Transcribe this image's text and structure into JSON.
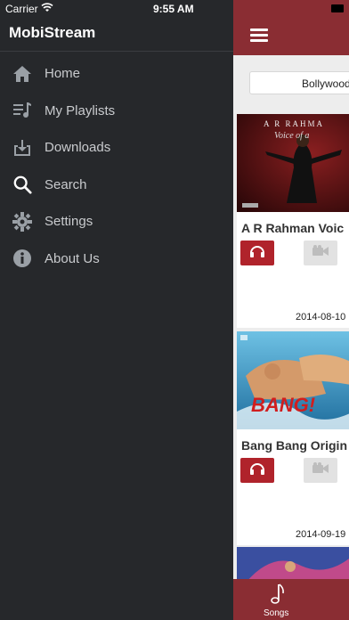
{
  "status": {
    "carrier": "Carrier",
    "time": "9:55 AM"
  },
  "drawer": {
    "title": "MobiStream",
    "items": [
      {
        "label": "Home",
        "icon": "home-icon"
      },
      {
        "label": "My Playlists",
        "icon": "playlist-icon"
      },
      {
        "label": "Downloads",
        "icon": "download-icon"
      },
      {
        "label": "Search",
        "icon": "search-icon"
      },
      {
        "label": "Settings",
        "icon": "gear-icon"
      },
      {
        "label": "About Us",
        "icon": "info-icon"
      }
    ]
  },
  "content": {
    "category": "Bollywood",
    "albums": [
      {
        "title": "A R Rahman Voic",
        "date": "2014-08-10"
      },
      {
        "title": "Bang Bang Origin",
        "date": "2014-09-19"
      }
    ],
    "tab": {
      "label": "Songs"
    }
  },
  "colors": {
    "accent": "#8a2d33",
    "button_red": "#b0232b",
    "drawer_bg": "#26282b"
  }
}
